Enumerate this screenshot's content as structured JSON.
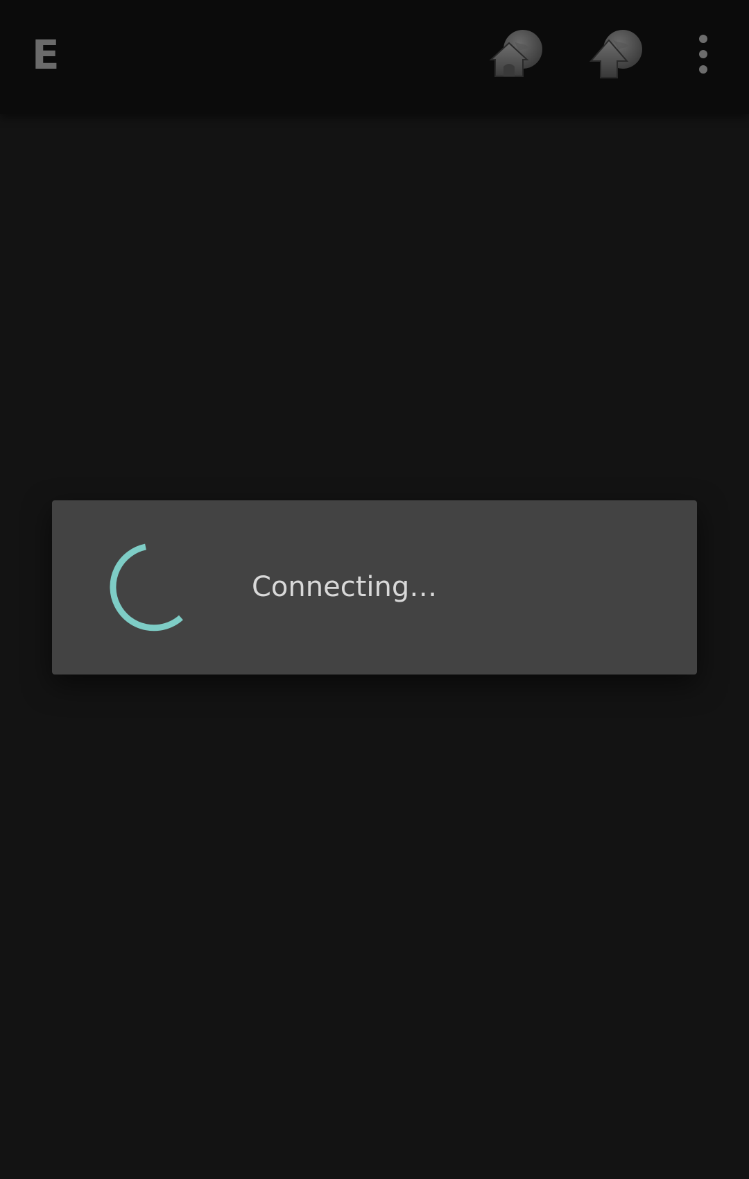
{
  "toolbar": {
    "title": "E",
    "actions": [
      {
        "icon": "home-icon"
      },
      {
        "icon": "up-folder-icon"
      },
      {
        "icon": "overflow-menu-icon"
      }
    ]
  },
  "dialog": {
    "message": "Connecting…",
    "spinner_color": "#7ecdc6"
  },
  "colors": {
    "background": "#131313",
    "toolbar": "#0b0b0b",
    "dialog": "#434343",
    "accent": "#7ecdc6"
  }
}
